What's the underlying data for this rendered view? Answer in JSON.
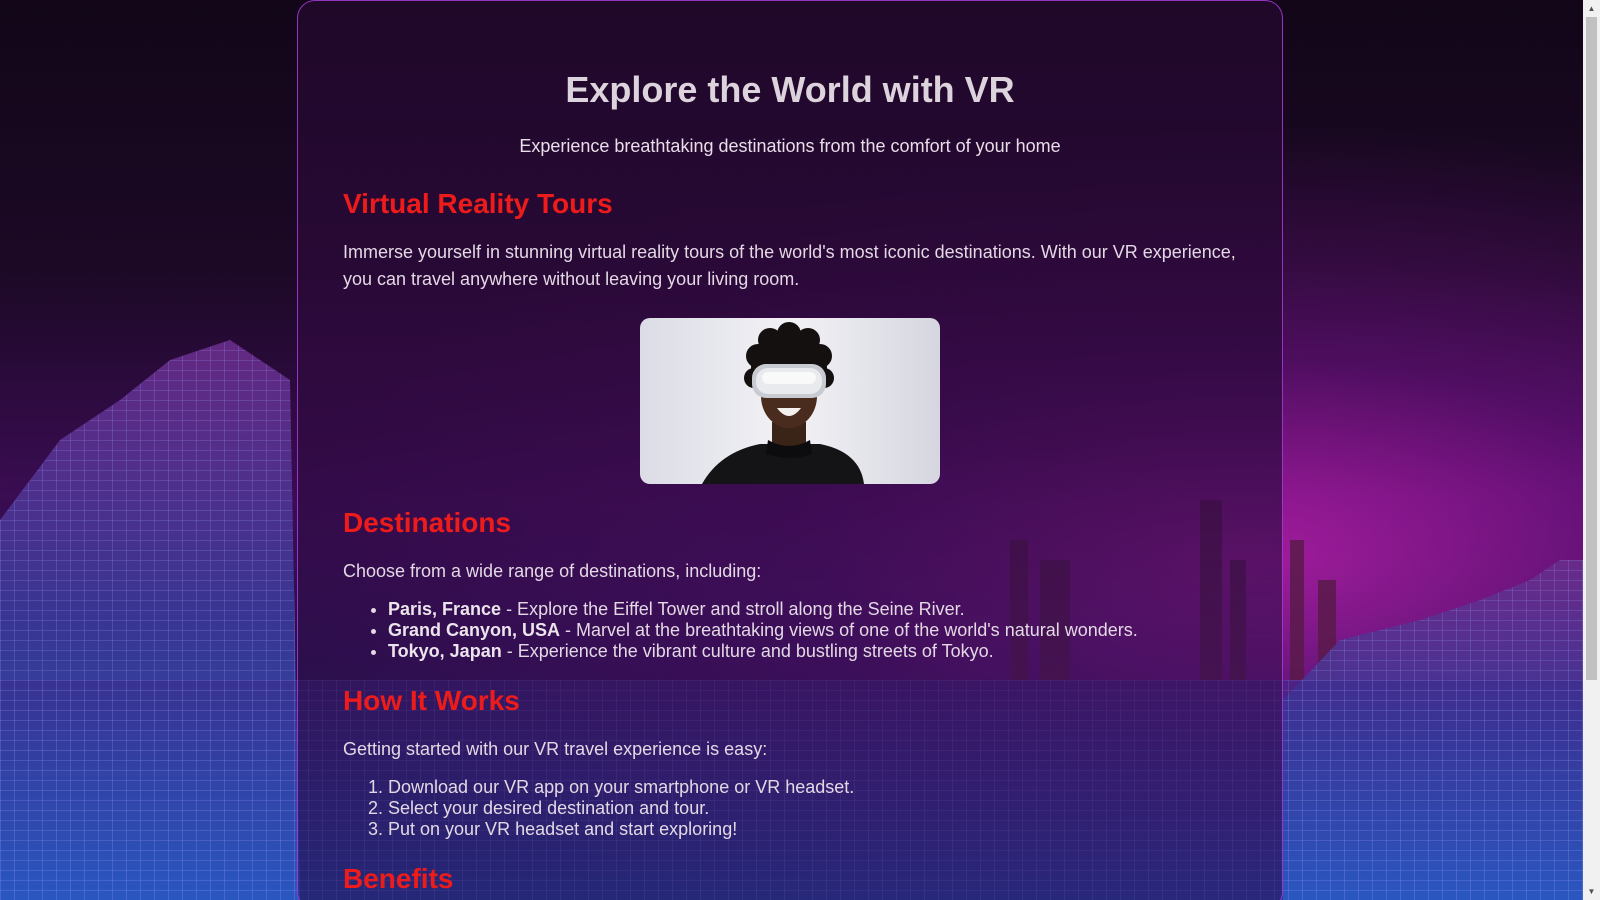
{
  "page": {
    "title": "Explore the World with VR",
    "subtitle": "Experience breathtaking destinations from the comfort of your home"
  },
  "sections": {
    "tours": {
      "heading": "Virtual Reality Tours",
      "text": "Immerse yourself in stunning virtual reality tours of the world's most iconic destinations. With our VR experience, you can travel anywhere without leaving your living room."
    },
    "destinations": {
      "heading": "Destinations",
      "intro": "Choose from a wide range of destinations, including:",
      "items": [
        {
          "name": "Paris, France",
          "desc": " - Explore the Eiffel Tower and stroll along the Seine River."
        },
        {
          "name": "Grand Canyon, USA",
          "desc": " - Marvel at the breathtaking views of one of the world's natural wonders."
        },
        {
          "name": "Tokyo, Japan",
          "desc": " - Experience the vibrant culture and bustling streets of Tokyo."
        }
      ]
    },
    "how": {
      "heading": "How It Works",
      "intro": "Getting started with our VR travel experience is easy:",
      "steps": [
        "Download our VR app on your smartphone or VR headset.",
        "Select your desired destination and tour.",
        "Put on your VR headset and start exploring!"
      ]
    },
    "benefits": {
      "heading": "Benefits"
    }
  },
  "colors": {
    "heading": "#ee1b1b",
    "card_border": "#aa3cdc",
    "background_glow": "#ff28dc"
  }
}
